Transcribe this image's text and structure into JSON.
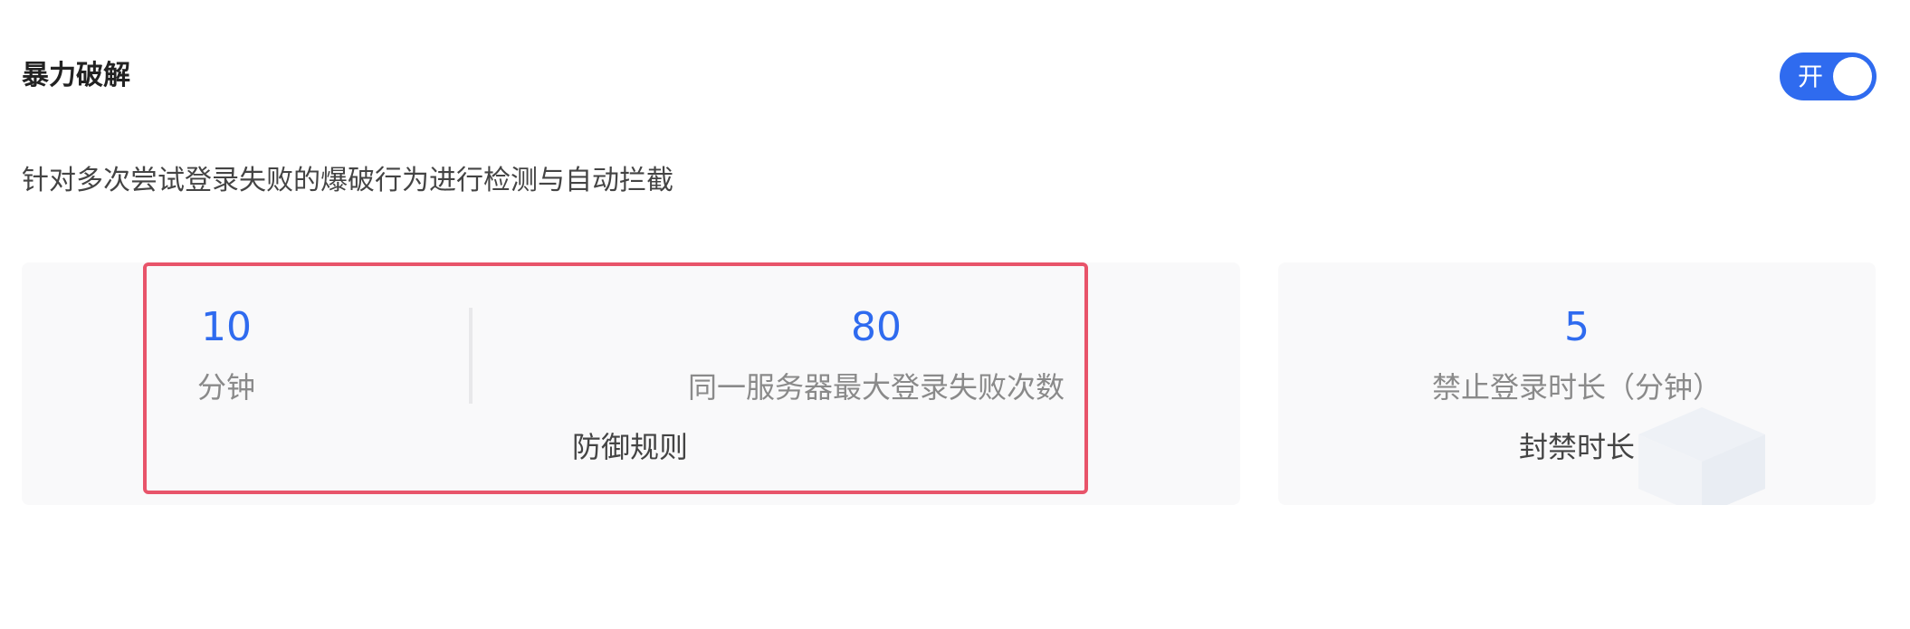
{
  "header": {
    "title": "暴力破解",
    "toggle": {
      "label": "开",
      "state": "on"
    }
  },
  "description": "针对多次尝试登录失败的爆破行为进行检测与自动拦截",
  "rule_card": {
    "minutes_value": "10",
    "minutes_label": "分钟",
    "max_fail_value": "80",
    "max_fail_label": "同一服务器最大登录失败次数",
    "footer": "防御规则"
  },
  "ban_card": {
    "value": "5",
    "label": "禁止登录时长（分钟）",
    "footer": "封禁时长"
  },
  "colors": {
    "accent": "#2f6bef",
    "highlight_border": "#e8546a",
    "card_bg": "#f9f9fa"
  }
}
